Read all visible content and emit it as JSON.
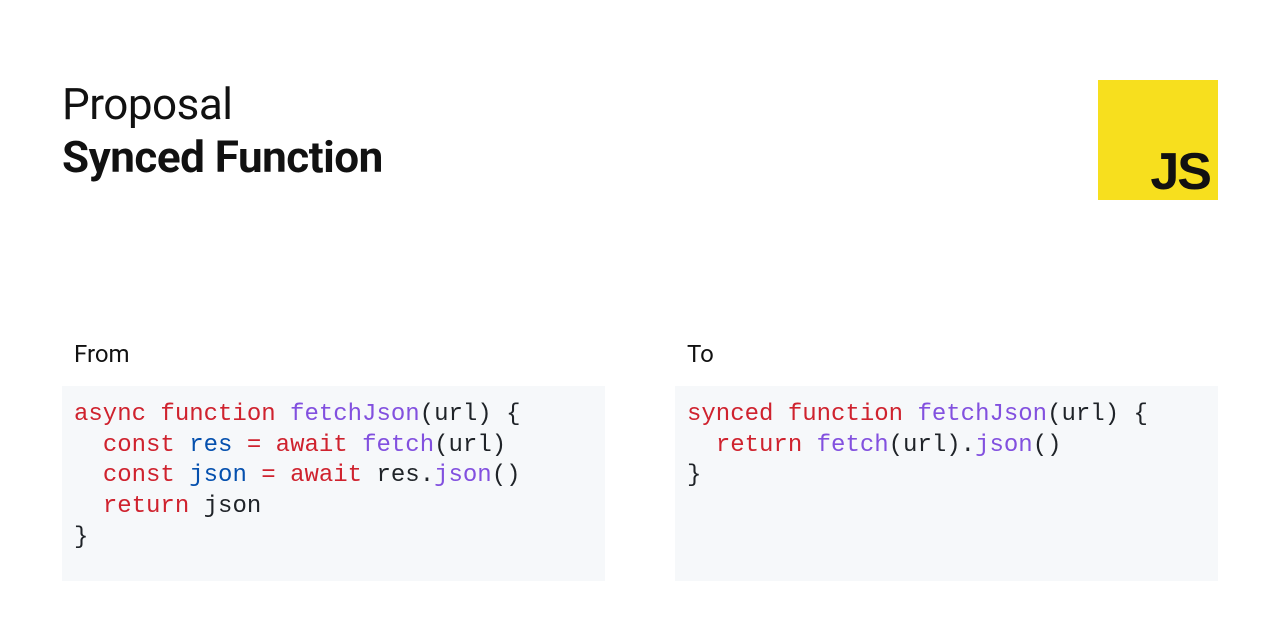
{
  "header": {
    "eyebrow": "Proposal",
    "title": "Synced Function",
    "logo_text": "JS"
  },
  "columns": {
    "from": {
      "label": "From"
    },
    "to": {
      "label": "To"
    }
  },
  "code": {
    "from": {
      "tokens": [
        [
          [
            "async",
            "red"
          ],
          [
            " ",
            "black"
          ],
          [
            "function",
            "red"
          ],
          [
            " ",
            "black"
          ],
          [
            "fetchJson",
            "purple"
          ],
          [
            "(url) {",
            "black"
          ]
        ],
        [
          [
            "  ",
            "black"
          ],
          [
            "const",
            "red"
          ],
          [
            " ",
            "black"
          ],
          [
            "res",
            "blue"
          ],
          [
            " ",
            "black"
          ],
          [
            "=",
            "red"
          ],
          [
            " ",
            "black"
          ],
          [
            "await",
            "red"
          ],
          [
            " ",
            "black"
          ],
          [
            "fetch",
            "purple"
          ],
          [
            "(url)",
            "black"
          ]
        ],
        [
          [
            "  ",
            "black"
          ],
          [
            "const",
            "red"
          ],
          [
            " ",
            "black"
          ],
          [
            "json",
            "blue"
          ],
          [
            " ",
            "black"
          ],
          [
            "=",
            "red"
          ],
          [
            " ",
            "black"
          ],
          [
            "await",
            "red"
          ],
          [
            " res.",
            "black"
          ],
          [
            "json",
            "purple"
          ],
          [
            "()",
            "black"
          ]
        ],
        [
          [
            "  ",
            "black"
          ],
          [
            "return",
            "red"
          ],
          [
            " json",
            "black"
          ]
        ],
        [
          [
            "}",
            "black"
          ]
        ]
      ]
    },
    "to": {
      "tokens": [
        [
          [
            "synced",
            "red"
          ],
          [
            " ",
            "black"
          ],
          [
            "function",
            "red"
          ],
          [
            " ",
            "black"
          ],
          [
            "fetchJson",
            "purple"
          ],
          [
            "(url) {",
            "black"
          ]
        ],
        [
          [
            "  ",
            "black"
          ],
          [
            "return",
            "red"
          ],
          [
            " ",
            "black"
          ],
          [
            "fetch",
            "purple"
          ],
          [
            "(url).",
            "black"
          ],
          [
            "json",
            "purple"
          ],
          [
            "()",
            "black"
          ]
        ],
        [
          [
            "}",
            "black"
          ]
        ]
      ]
    }
  }
}
